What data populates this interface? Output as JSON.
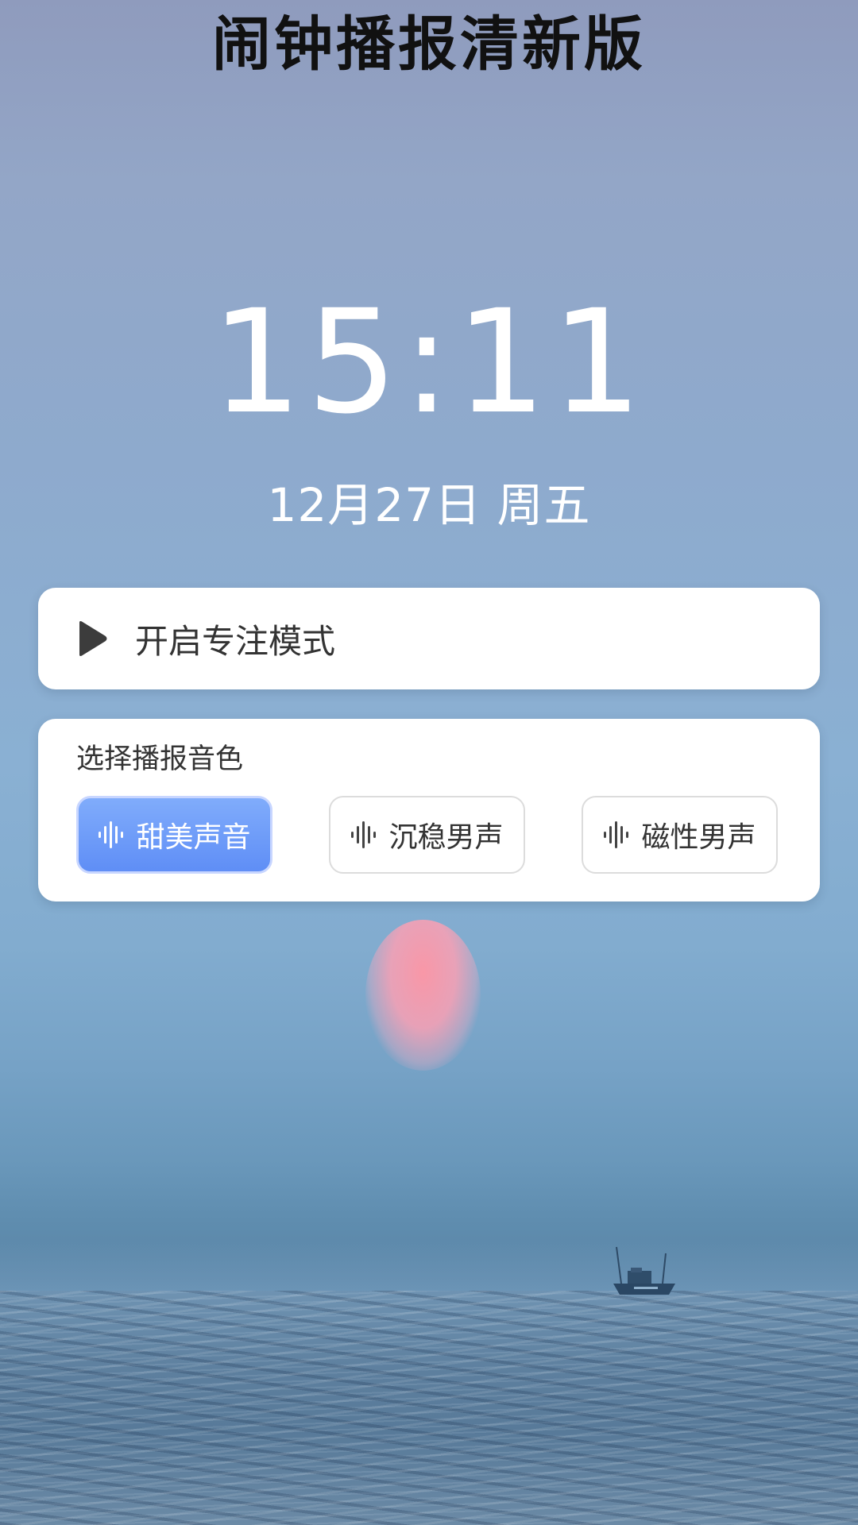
{
  "header": {
    "title": "闹钟播报清新版"
  },
  "clock": {
    "time": "15:11",
    "date": "12月27日 周五"
  },
  "focus": {
    "label": "开启专注模式",
    "icon": "play-icon"
  },
  "voice": {
    "title": "选择播报音色",
    "options": [
      {
        "label": "甜美声音",
        "selected": true
      },
      {
        "label": "沉稳男声",
        "selected": false
      },
      {
        "label": "磁性男声",
        "selected": false
      }
    ],
    "icon": "sound-wave-icon"
  },
  "colors": {
    "selected_gradient_top": "#80acfb",
    "selected_gradient_bottom": "#5f8ef6",
    "card_background": "#ffffff",
    "title_text": "#111111"
  }
}
